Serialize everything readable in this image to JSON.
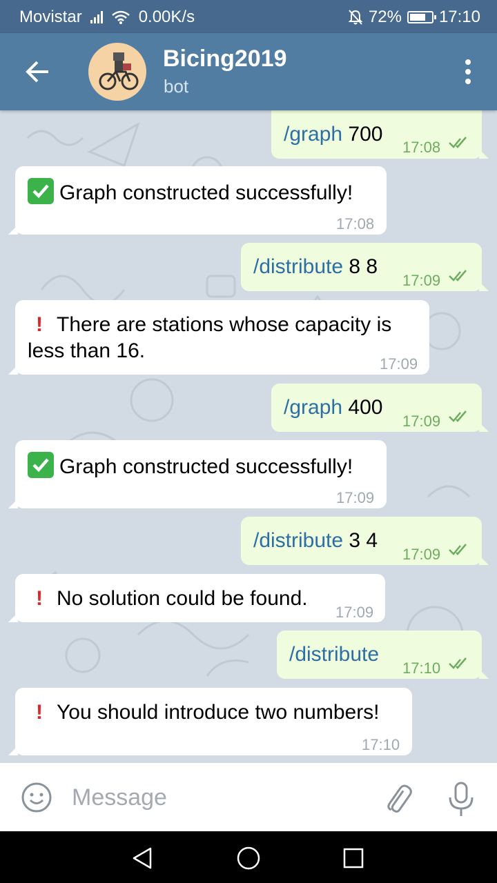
{
  "status_bar": {
    "carrier": "Movistar",
    "network_speed": "0.00K/s",
    "battery": "72%",
    "time": "17:10",
    "icons": [
      "signal-icon",
      "wifi-icon",
      "bell-muted-icon",
      "battery-icon"
    ]
  },
  "header": {
    "title": "Bicing2019",
    "subtitle": "bot",
    "icons": [
      "back-arrow-icon",
      "bot-avatar",
      "more-vert-icon"
    ]
  },
  "messages": [
    {
      "dir": "out",
      "command": "/graph",
      "args": " 700",
      "time": "17:08"
    },
    {
      "dir": "in",
      "emoji": "check-mark-icon",
      "text": "Graph constructed successfully!",
      "time": "17:08"
    },
    {
      "dir": "out",
      "command": "/distribute",
      "args": " 8 8",
      "time": "17:09"
    },
    {
      "dir": "in",
      "emoji": "exclamation-icon",
      "line1": "There are stations whose capacity is",
      "line2": "less than 16.",
      "time": "17:09"
    },
    {
      "dir": "out",
      "command": "/graph",
      "args": " 400",
      "time": "17:09"
    },
    {
      "dir": "in",
      "emoji": "check-mark-icon",
      "text": "Graph constructed successfully!",
      "time": "17:09"
    },
    {
      "dir": "out",
      "command": "/distribute",
      "args": " 3 4",
      "time": "17:09"
    },
    {
      "dir": "in",
      "emoji": "exclamation-icon",
      "text": "No solution could be found.",
      "time": "17:09"
    },
    {
      "dir": "out",
      "command": "/distribute",
      "args": "",
      "time": "17:10"
    },
    {
      "dir": "in",
      "emoji": "exclamation-icon",
      "text": "You should introduce two numbers!",
      "time": "17:10"
    }
  ],
  "input": {
    "placeholder": "Message",
    "value": ""
  },
  "colors": {
    "header": "#527da3",
    "status_bar": "#46698d",
    "chat_bg": "#d2dbe3",
    "outgoing_bubble": "#effdde",
    "incoming_bubble": "#ffffff",
    "command_link": "#2d6ea4",
    "read_ticks": "#6dac5e"
  }
}
